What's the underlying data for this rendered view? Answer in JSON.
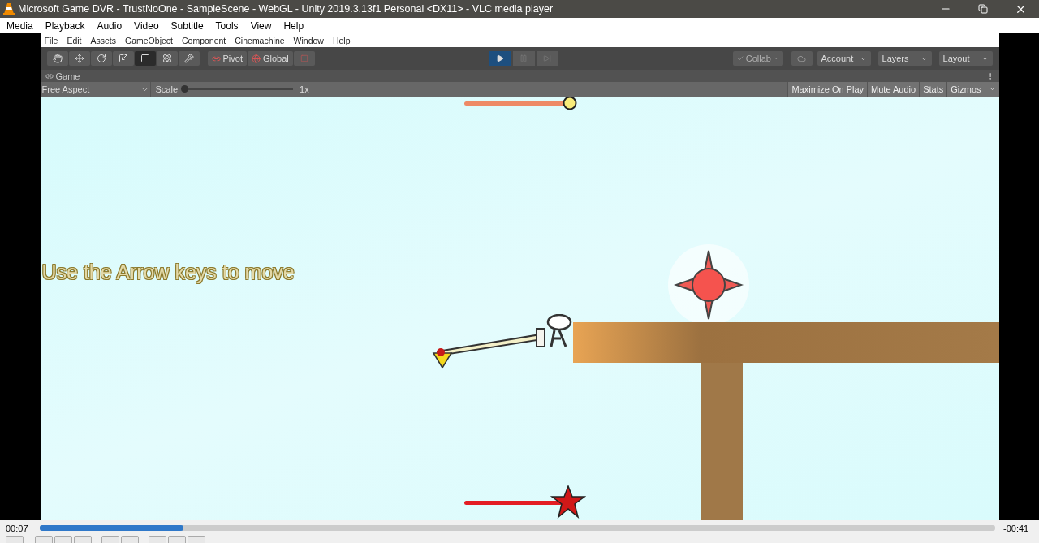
{
  "window": {
    "title": "Microsoft Game DVR - TrustNoOne - SampleScene - WebGL - Unity 2019.3.13f1 Personal <DX11> - VLC media player"
  },
  "vlc_menu": [
    "Media",
    "Playback",
    "Audio",
    "Video",
    "Subtitle",
    "Tools",
    "View",
    "Help"
  ],
  "unity": {
    "menu": [
      "File",
      "Edit",
      "Assets",
      "GameObject",
      "Component",
      "Cinemachine",
      "Window",
      "Help"
    ],
    "tools": [
      {
        "kind": "hand",
        "selected": false
      },
      {
        "kind": "move",
        "selected": false
      },
      {
        "kind": "rotate",
        "selected": false
      },
      {
        "kind": "scale",
        "selected": false
      },
      {
        "kind": "rect",
        "selected": true
      },
      {
        "kind": "transform",
        "selected": false
      },
      {
        "kind": "custom",
        "selected": false
      }
    ],
    "pivot": "Pivot",
    "global": "Global",
    "playing": true,
    "collab": "Collab",
    "account": "Account",
    "layers": "Layers",
    "layout": "Layout",
    "game_tab": "Game",
    "aspect": "Free Aspect",
    "scale": {
      "label": "Scale",
      "level": 0,
      "reading": "1x"
    },
    "toggles": [
      "Maximize On Play",
      "Mute Audio",
      "Stats",
      "Gizmos"
    ]
  },
  "game": {
    "hint": "Use the Arrow keys to move"
  },
  "player": {
    "elapsed": "00:07",
    "remaining": "-00:41",
    "seek": {
      "level": 0.15
    }
  }
}
